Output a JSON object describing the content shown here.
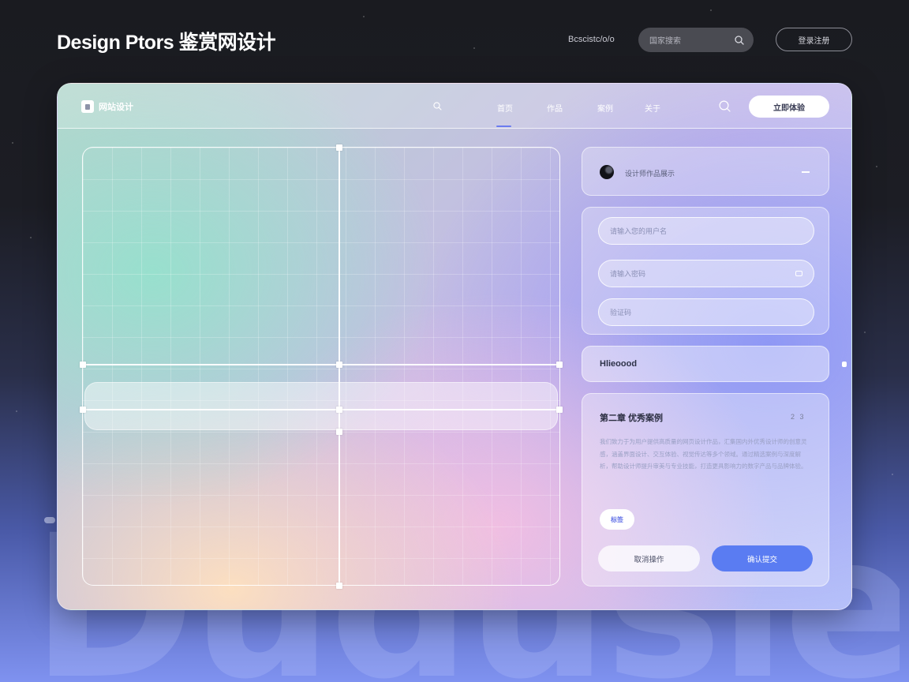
{
  "header": {
    "title": "Design Ptors 鉴赏网设计",
    "link": "Bcscistc/o/o",
    "search_placeholder": "国家搜索",
    "action_button": "登录注册"
  },
  "card": {
    "brand": "网站设计",
    "nav_items": [
      "首页",
      "作品",
      "案例",
      "关于"
    ],
    "cta_label": "立即体验",
    "colors": {
      "accent": "#5a7cf2",
      "nav_underline": "#6b7cf0"
    }
  },
  "panels": {
    "profile": {
      "text": "设计师作品展示"
    },
    "form": {
      "field1_placeholder": "请输入您的用户名",
      "field2_placeholder": "请输入密码",
      "field3_placeholder": "验证码"
    },
    "section_label": "Hlieoood",
    "detail": {
      "title": "第二章 优秀案例",
      "meta": "2 3",
      "body": "我们致力于为用户提供高质量的网页设计作品，汇集国内外优秀设计师的创意灵感，涵盖界面设计、交互体验、视觉传达等多个领域。通过精选案例与深度解析，帮助设计师提升审美与专业技能，打造更具影响力的数字产品与品牌体验。",
      "tag": "标签",
      "secondary_button": "取消操作",
      "primary_button": "确认提交"
    }
  },
  "background_word": "Dudusied",
  "icons": [
    "search-icon",
    "brand-logo-icon",
    "avatar",
    "minus-icon",
    "eye-icon"
  ]
}
